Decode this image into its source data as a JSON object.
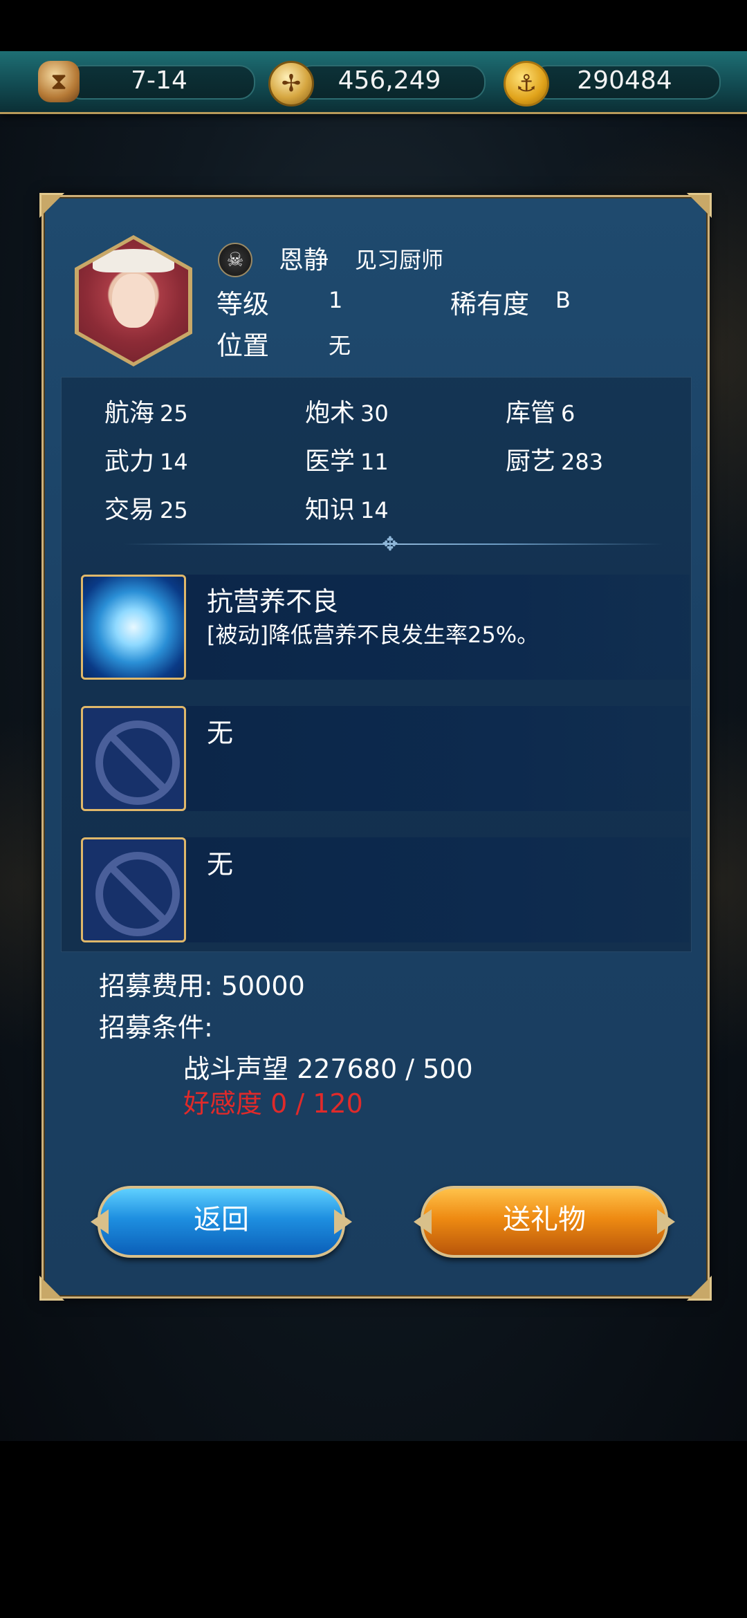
{
  "topbar": {
    "date": "7-14",
    "gold": "456,249",
    "coins": "290484",
    "icons": [
      "hourglass-icon",
      "compass-icon",
      "anchor-icon"
    ]
  },
  "character": {
    "name": "恩静",
    "title": "见习厨师",
    "level_label": "等级",
    "level": "1",
    "rarity_label": "稀有度",
    "rarity": "B",
    "position_label": "位置",
    "position": "无"
  },
  "stats": [
    {
      "label": "航海",
      "value": "25"
    },
    {
      "label": "炮术",
      "value": "30"
    },
    {
      "label": "库管",
      "value": "6"
    },
    {
      "label": "武力",
      "value": "14"
    },
    {
      "label": "医学",
      "value": "11"
    },
    {
      "label": "厨艺",
      "value": "283"
    },
    {
      "label": "交易",
      "value": "25"
    },
    {
      "label": "知识",
      "value": "14"
    }
  ],
  "skills": [
    {
      "name": "抗营养不良",
      "desc": "[被动]降低营养不良发生率25%。",
      "icon": "stomach-icon"
    },
    {
      "name": "无",
      "desc": "",
      "icon": "no-entry-icon"
    },
    {
      "name": "无",
      "desc": "",
      "icon": "no-entry-icon"
    }
  ],
  "recruit": {
    "cost_label": "招募费用: 50000",
    "cond_label": "招募条件:",
    "cond1": "战斗声望 227680 / 500",
    "cond2": "好感度 0 / 120"
  },
  "buttons": {
    "back": "返回",
    "gift": "送礼物"
  },
  "colors": {
    "panel": "#1f4a6e",
    "border": "#cdb07a",
    "unmet": "#e02a2a"
  }
}
